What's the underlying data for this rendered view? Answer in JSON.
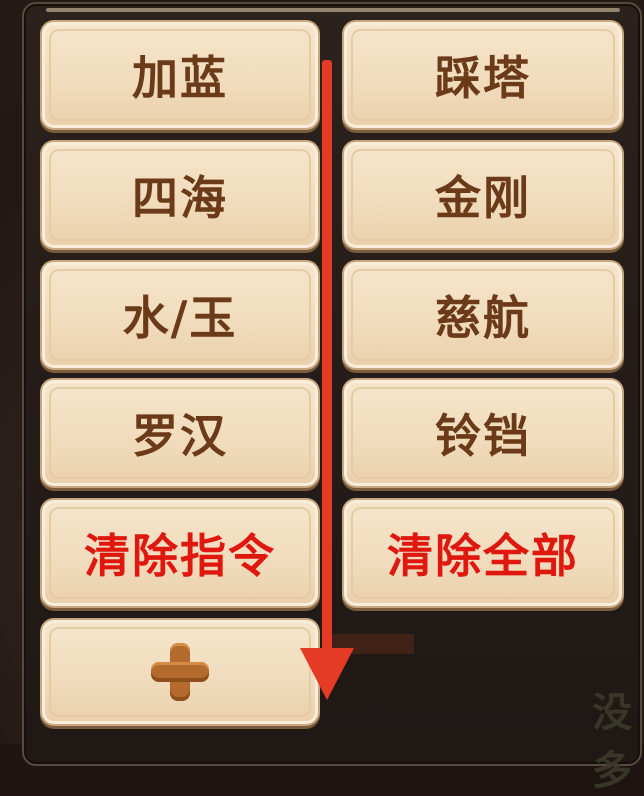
{
  "buttons": {
    "jialan": "加蓝",
    "caita": "踩塔",
    "sihai": "四海",
    "jingang": "金刚",
    "shuiyu": "水/玉",
    "cihang": "慈航",
    "luohan": "罗汉",
    "lingdang": "铃铛",
    "clear_command": "清除指令",
    "clear_all": "清除全部"
  },
  "background_text": "没多",
  "colors": {
    "button_text": "#6b3a18",
    "clear_text": "#e0170f",
    "arrow": "#e53a26",
    "plus": "#b36a2c"
  },
  "icons": {
    "add": "plus-icon",
    "annotation": "down-arrow"
  }
}
